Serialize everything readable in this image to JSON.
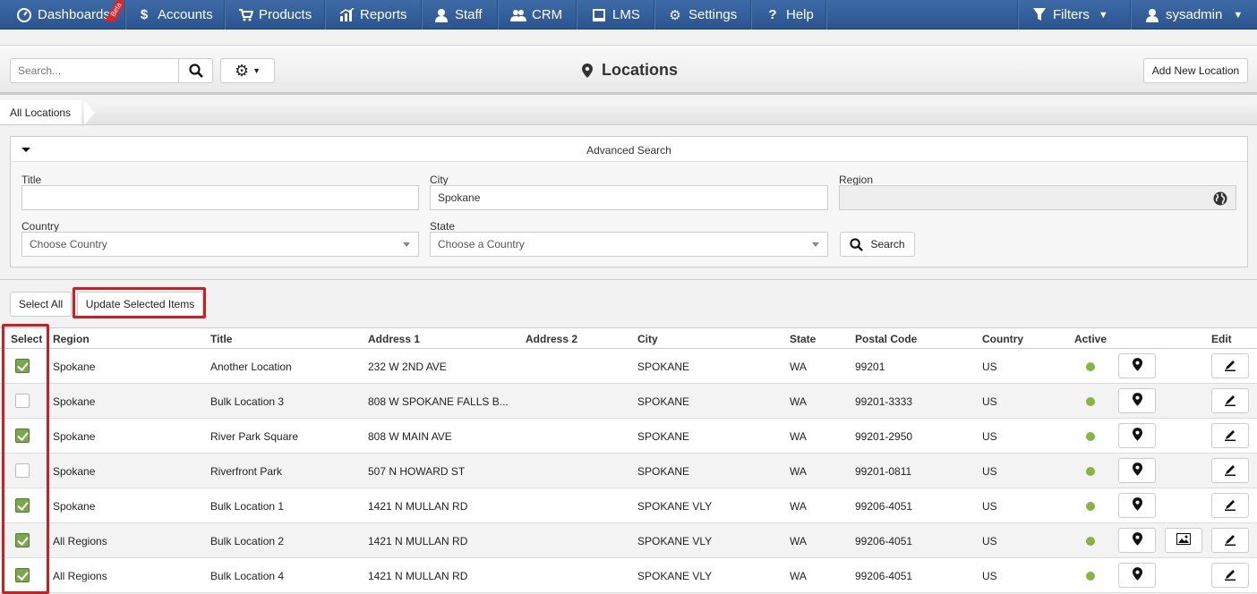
{
  "nav": {
    "items": [
      {
        "label": "Dashboards",
        "icon": "dashboard-icon"
      },
      {
        "label": "Accounts",
        "icon": "dollar-icon"
      },
      {
        "label": "Products",
        "icon": "cart-icon"
      },
      {
        "label": "Reports",
        "icon": "chart-icon"
      },
      {
        "label": "Staff",
        "icon": "user-icon"
      },
      {
        "label": "CRM",
        "icon": "users-icon"
      },
      {
        "label": "LMS",
        "icon": "book-icon"
      },
      {
        "label": "Settings",
        "icon": "gear-icon"
      },
      {
        "label": "Help",
        "icon": "question-icon"
      }
    ],
    "beta": "Beta",
    "filters": "Filters",
    "user": "sysadmin"
  },
  "toolbar": {
    "search_placeholder": "Search...",
    "page_title": "Locations",
    "add_label": "Add New Location"
  },
  "breadcrumb": {
    "label": "All Locations"
  },
  "advanced": {
    "title": "Advanced Search",
    "title_label": "Title",
    "title_value": "",
    "city_label": "City",
    "city_value": "Spokane",
    "region_label": "Region",
    "country_label": "Country",
    "country_value": "Choose Country",
    "state_label": "State",
    "state_value": "Choose a Country",
    "search_label": "Search"
  },
  "bulk": {
    "select_all": "Select All",
    "update": "Update Selected Items"
  },
  "table": {
    "headers": [
      "Select",
      "Region",
      "Title",
      "Address 1",
      "Address 2",
      "City",
      "State",
      "Postal Code",
      "Country",
      "Active",
      "Edit"
    ],
    "rows": [
      {
        "checked": true,
        "region": "Spokane",
        "title": "Another Location",
        "address1": "232 W 2ND AVE",
        "address2": "",
        "city": "SPOKANE",
        "state": "WA",
        "postal": "99201",
        "country": "US",
        "image": false
      },
      {
        "checked": false,
        "region": "Spokane",
        "title": "Bulk Location 3",
        "address1": "808 W SPOKANE FALLS B...",
        "address2": "",
        "city": "SPOKANE",
        "state": "WA",
        "postal": "99201-3333",
        "country": "US",
        "image": false
      },
      {
        "checked": true,
        "region": "Spokane",
        "title": "River Park Square",
        "address1": "808 W MAIN AVE",
        "address2": "",
        "city": "SPOKANE",
        "state": "WA",
        "postal": "99201-2950",
        "country": "US",
        "image": false
      },
      {
        "checked": false,
        "region": "Spokane",
        "title": "Riverfront Park",
        "address1": "507 N HOWARD ST",
        "address2": "",
        "city": "SPOKANE",
        "state": "WA",
        "postal": "99201-0811",
        "country": "US",
        "image": false
      },
      {
        "checked": true,
        "region": "Spokane",
        "title": "Bulk Location 1",
        "address1": "1421 N MULLAN RD",
        "address2": "",
        "city": "SPOKANE VLY",
        "state": "WA",
        "postal": "99206-4051",
        "country": "US",
        "image": false
      },
      {
        "checked": true,
        "region": "All Regions",
        "title": "Bulk Location 2",
        "address1": "1421 N MULLAN RD",
        "address2": "",
        "city": "SPOKANE VLY",
        "state": "WA",
        "postal": "99206-4051",
        "country": "US",
        "image": true
      },
      {
        "checked": true,
        "region": "All Regions",
        "title": "Bulk Location 4",
        "address1": "1421 N MULLAN RD",
        "address2": "",
        "city": "SPOKANE VLY",
        "state": "WA",
        "postal": "99206-4051",
        "country": "US",
        "image": false
      }
    ]
  },
  "colors": {
    "nav": "#2f5b97",
    "highlight": "#d01d22",
    "active": "#86b540",
    "check": "#7aa84a"
  }
}
